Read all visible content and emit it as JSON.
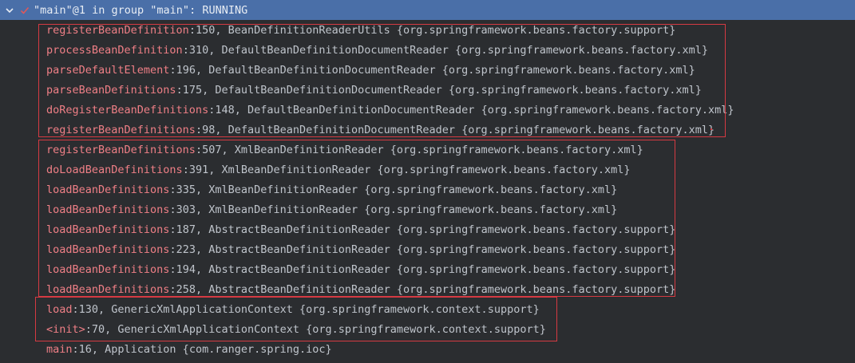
{
  "thread": {
    "title": "\"main\"@1 in group \"main\": RUNNING"
  },
  "colors": {
    "header_bg": "#4a6fa8",
    "method": "#ef7f86",
    "highlight_box": "#d63a42",
    "check": "#e0585a"
  },
  "frames": [
    {
      "method": "registerBeanDefinition",
      "rest": ":150, BeanDefinitionReaderUtils {org.springframework.beans.factory.support}"
    },
    {
      "method": "processBeanDefinition",
      "rest": ":310, DefaultBeanDefinitionDocumentReader {org.springframework.beans.factory.xml}"
    },
    {
      "method": "parseDefaultElement",
      "rest": ":196, DefaultBeanDefinitionDocumentReader {org.springframework.beans.factory.xml}"
    },
    {
      "method": "parseBeanDefinitions",
      "rest": ":175, DefaultBeanDefinitionDocumentReader {org.springframework.beans.factory.xml}"
    },
    {
      "method": "doRegisterBeanDefinitions",
      "rest": ":148, DefaultBeanDefinitionDocumentReader {org.springframework.beans.factory.xml}"
    },
    {
      "method": "registerBeanDefinitions",
      "rest": ":98, DefaultBeanDefinitionDocumentReader {org.springframework.beans.factory.xml}"
    },
    {
      "method": "registerBeanDefinitions",
      "rest": ":507, XmlBeanDefinitionReader {org.springframework.beans.factory.xml}"
    },
    {
      "method": "doLoadBeanDefinitions",
      "rest": ":391, XmlBeanDefinitionReader {org.springframework.beans.factory.xml}"
    },
    {
      "method": "loadBeanDefinitions",
      "rest": ":335, XmlBeanDefinitionReader {org.springframework.beans.factory.xml}"
    },
    {
      "method": "loadBeanDefinitions",
      "rest": ":303, XmlBeanDefinitionReader {org.springframework.beans.factory.xml}"
    },
    {
      "method": "loadBeanDefinitions",
      "rest": ":187, AbstractBeanDefinitionReader {org.springframework.beans.factory.support}"
    },
    {
      "method": "loadBeanDefinitions",
      "rest": ":223, AbstractBeanDefinitionReader {org.springframework.beans.factory.support}"
    },
    {
      "method": "loadBeanDefinitions",
      "rest": ":194, AbstractBeanDefinitionReader {org.springframework.beans.factory.support}"
    },
    {
      "method": "loadBeanDefinitions",
      "rest": ":258, AbstractBeanDefinitionReader {org.springframework.beans.factory.support}"
    },
    {
      "method": "load",
      "rest": ":130, GenericXmlApplicationContext {org.springframework.context.support}"
    },
    {
      "method": "<init>",
      "rest": ":70, GenericXmlApplicationContext {org.springframework.context.support}"
    },
    {
      "method": "main",
      "rest": ":16, Application {com.ranger.spring.ioc}"
    }
  ]
}
